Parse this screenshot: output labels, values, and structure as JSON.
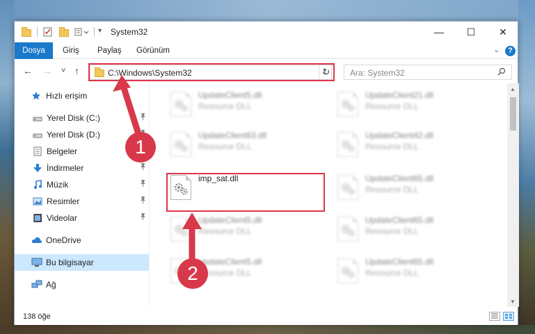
{
  "window": {
    "title": "System32",
    "minimize_icon": "—",
    "maximize_icon": "☐",
    "close_icon": "✕"
  },
  "ribbon": {
    "tabs": [
      "Dosya",
      "Giriş",
      "Paylaş",
      "Görünüm"
    ],
    "active_tab": "Dosya",
    "help_label": "?",
    "expand_icon": "⌄"
  },
  "navigation": {
    "back_icon": "←",
    "forward_icon": "→",
    "recent_icon": "˅",
    "up_icon": "↑",
    "address": "C:\\Windows\\System32",
    "address_chevron": "⌄",
    "refresh_icon": "↻",
    "search_placeholder": "Ara: System32",
    "search_icon": "⚲"
  },
  "sidebar": {
    "items": [
      {
        "label": "Hızlı erişim",
        "icon": "star-icon",
        "pinned": false,
        "top_level": true
      },
      {
        "label": "Yerel Disk (C:)",
        "icon": "drive-icon",
        "pinned": true
      },
      {
        "label": "Yerel Disk (D:)",
        "icon": "drive-icon",
        "pinned": true
      },
      {
        "label": "Belgeler",
        "icon": "document-icon",
        "pinned": true
      },
      {
        "label": "İndirmeler",
        "icon": "download-icon",
        "pinned": true
      },
      {
        "label": "Müzik",
        "icon": "music-icon",
        "pinned": true
      },
      {
        "label": "Resimler",
        "icon": "pictures-icon",
        "pinned": true
      },
      {
        "label": "Videolar",
        "icon": "video-icon",
        "pinned": true
      },
      {
        "label": "OneDrive",
        "icon": "cloud-icon",
        "pinned": false,
        "top_level": true
      },
      {
        "label": "Bu bilgisayar",
        "icon": "computer-icon",
        "pinned": false,
        "top_level": true,
        "selected": true
      },
      {
        "label": "Ağ",
        "icon": "network-icon",
        "pinned": false,
        "top_level": true
      }
    ],
    "pin_icon": "📌"
  },
  "files": [
    {
      "name": "UpdateClient5.dll",
      "type": "Resource DLL",
      "blurred": true
    },
    {
      "name": "UpdateClient21.dll",
      "type": "Resource DLL",
      "blurred": true
    },
    {
      "name": "UpdateClient63.dll",
      "type": "Resource DLL",
      "blurred": true
    },
    {
      "name": "UpdateClient42.dll",
      "type": "Resource DLL",
      "blurred": true
    },
    {
      "name": "imp_sat.dll",
      "type": "",
      "blurred": false
    },
    {
      "name": "UpdateClient65.dll",
      "type": "Resource DLL",
      "blurred": true
    },
    {
      "name": "UpdateClient5.dll",
      "type": "Resource DLL",
      "blurred": true
    },
    {
      "name": "UpdateClient65.dll",
      "type": "Resource DLL",
      "blurred": true
    },
    {
      "name": "UpdateClient5.dll",
      "type": "Resource DLL",
      "blurred": true
    },
    {
      "name": "UpdateClient65.dll",
      "type": "Resource DLL",
      "blurred": true
    }
  ],
  "status": {
    "item_count": "138 öğe"
  },
  "annotations": {
    "step1": "1",
    "step2": "2",
    "color": "#d8394a"
  }
}
